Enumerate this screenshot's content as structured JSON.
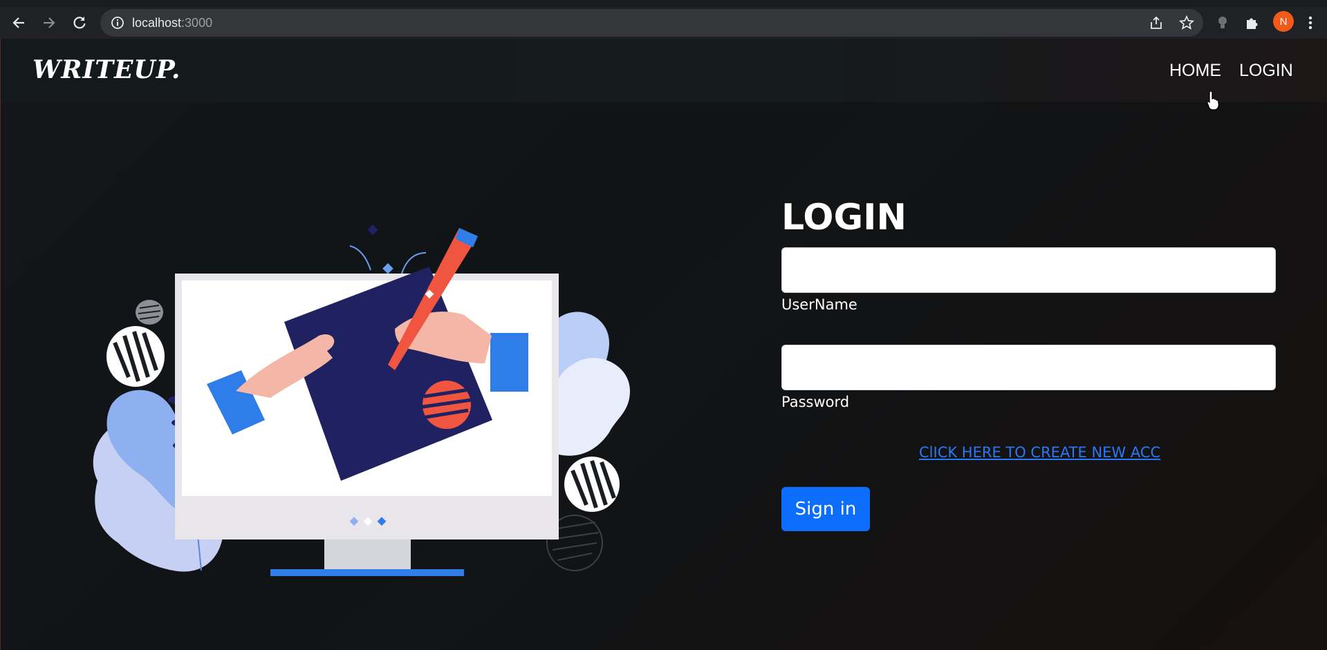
{
  "browser": {
    "url_host": "localhost",
    "url_port": ":3000",
    "profile_initial": "N",
    "icons": [
      "back-icon",
      "forward-icon",
      "reload-icon",
      "info-icon",
      "share-icon",
      "star-icon",
      "extension-bulb-icon",
      "puzzle-icon",
      "menu-dots-icon"
    ]
  },
  "site": {
    "logo": "WRITEUP.",
    "nav": {
      "home": "HOME",
      "login": "LOGIN"
    }
  },
  "login_form": {
    "title": "LOGIN",
    "username_label": "UserName",
    "username_value": "",
    "password_label": "Password",
    "password_value": "",
    "create_account_link": "ClICK HERE TO CREATE NEW ACC",
    "signin_button": "Sign in"
  },
  "colors": {
    "accent": "#0d6efd",
    "link": "#2b78f7",
    "profile": "#f05a1a",
    "illustration_navy": "#1f2160",
    "illustration_blue": "#2f7de8",
    "illustration_red": "#f0553f"
  }
}
